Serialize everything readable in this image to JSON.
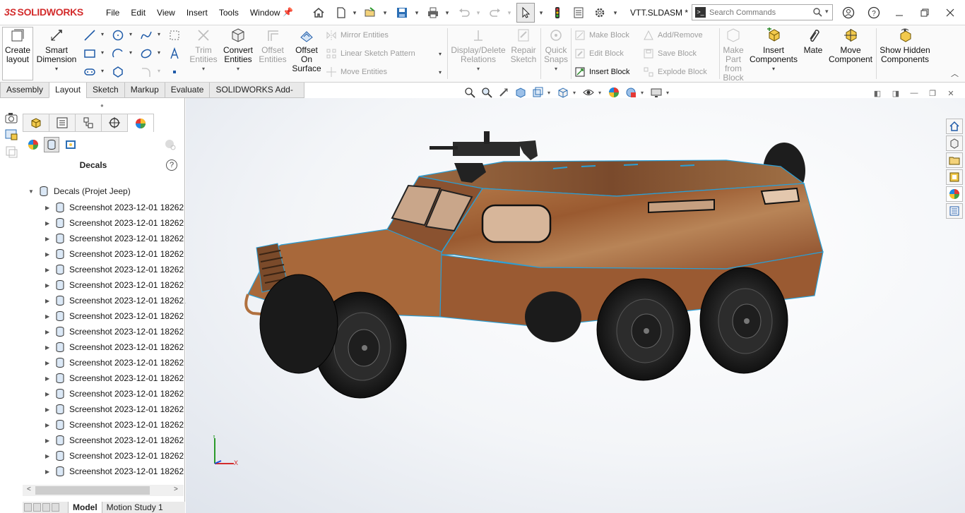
{
  "app": {
    "brand_prefix": "3S",
    "brand": "SOLIDWORKS",
    "document_title": "VTT.SLDASM *"
  },
  "menu": [
    "File",
    "Edit",
    "View",
    "Insert",
    "Tools",
    "Window"
  ],
  "search": {
    "placeholder": "Search Commands"
  },
  "ribbon": {
    "create_layout": "Create layout",
    "smart_dimension": "Smart Dimension",
    "trim_entities": "Trim Entities",
    "convert_entities": "Convert Entities",
    "offset_entities": "Offset Entities",
    "offset_on_surface": "Offset On Surface",
    "mirror_entities": "Mirror Entities",
    "linear_sketch_pattern": "Linear Sketch Pattern",
    "move_entities": "Move Entities",
    "display_delete_relations": "Display/Delete Relations",
    "repair_sketch": "Repair Sketch",
    "quick_snaps": "Quick Snaps",
    "make_block": "Make Block",
    "edit_block": "Edit Block",
    "insert_block": "Insert Block",
    "add_remove": "Add/Remove",
    "save_block": "Save Block",
    "explode_block": "Explode Block",
    "make_part_from_block": "Make Part from Block",
    "insert_components": "Insert Components",
    "mate": "Mate",
    "move_component": "Move Component",
    "show_hidden_components": "Show Hidden Components"
  },
  "tabs": [
    {
      "label": "Assembly",
      "active": false
    },
    {
      "label": "Layout",
      "active": true
    },
    {
      "label": "Sketch",
      "active": false
    },
    {
      "label": "Markup",
      "active": false
    },
    {
      "label": "Evaluate",
      "active": false
    },
    {
      "label": "SOLIDWORKS Add-Ins",
      "active": false
    }
  ],
  "panel": {
    "title": "Decals",
    "help": "?",
    "root": "Decals (Projet Jeep)",
    "items": [
      "Screenshot 2023-12-01 18262",
      "Screenshot 2023-12-01 18262",
      "Screenshot 2023-12-01 18262",
      "Screenshot 2023-12-01 18262",
      "Screenshot 2023-12-01 18262",
      "Screenshot 2023-12-01 18262",
      "Screenshot 2023-12-01 18262",
      "Screenshot 2023-12-01 18262",
      "Screenshot 2023-12-01 18262",
      "Screenshot 2023-12-01 18262",
      "Screenshot 2023-12-01 18262",
      "Screenshot 2023-12-01 18262",
      "Screenshot 2023-12-01 18262",
      "Screenshot 2023-12-01 18262",
      "Screenshot 2023-12-01 18262",
      "Screenshot 2023-12-01 18262",
      "Screenshot 2023-12-01 18262",
      "Screenshot 2023-12-01 18262"
    ]
  },
  "bottom_tabs": [
    {
      "label": "Model",
      "active": true
    },
    {
      "label": "Motion Study 1",
      "active": false
    }
  ],
  "triad": {
    "y": "Y",
    "x": "X"
  },
  "colors": {
    "brand_red": "#d32c2c",
    "accent_blue": "#1e6fd9",
    "vehicle_body": "#a8683a",
    "edge_highlight": "#2a9fd6",
    "tire": "#1e1e1e"
  }
}
